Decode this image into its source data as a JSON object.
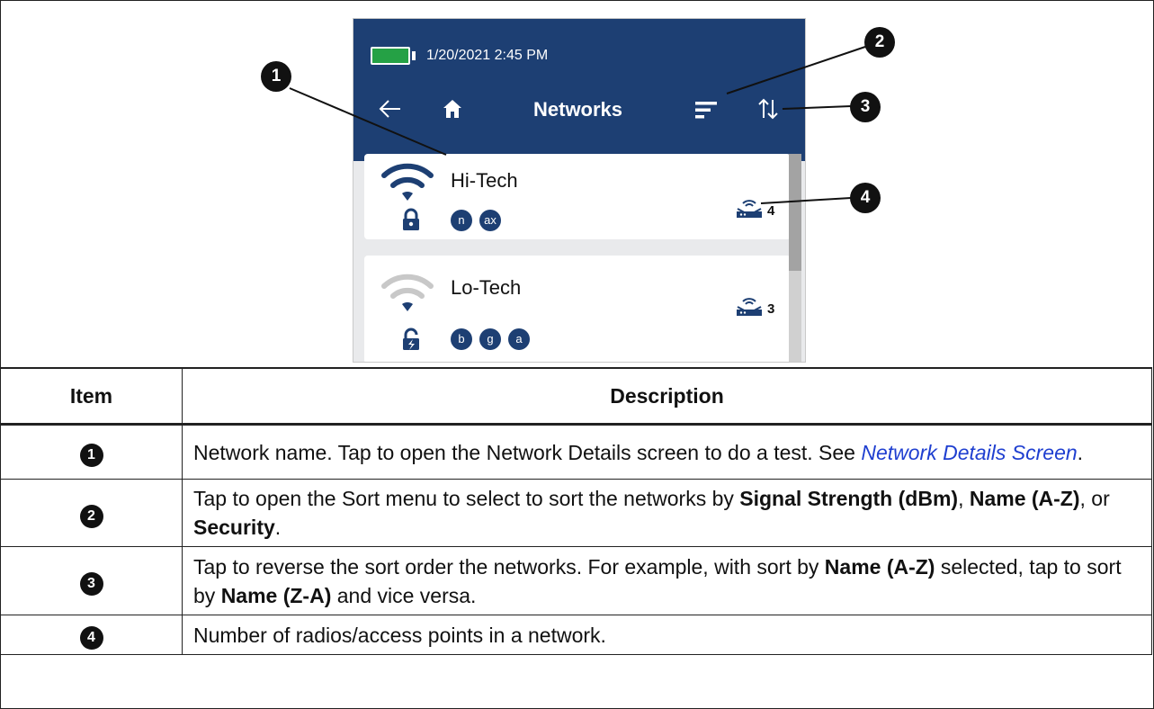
{
  "device": {
    "datetime": "1/20/2021 2:45 PM",
    "title": "Networks",
    "battery_color": "#25a145",
    "header_color": "#1d3f73",
    "networks": [
      {
        "name": "Hi-Tech",
        "signal": "strong",
        "security": "locked",
        "badges": [
          "n",
          "ax"
        ],
        "ap_count": "4"
      },
      {
        "name": "Lo-Tech",
        "signal": "weak",
        "security": "unlocked",
        "badges": [
          "b",
          "g",
          "a"
        ],
        "ap_count": "3"
      }
    ]
  },
  "callouts": [
    "1",
    "2",
    "3",
    "4"
  ],
  "table": {
    "headers": {
      "item": "Item",
      "description": "Description"
    },
    "rows": [
      {
        "item": "1",
        "t1": "Network name. Tap to open the Network Details screen to do a test. See ",
        "link": "Network Details Screen",
        "t2": "."
      },
      {
        "item": "2",
        "t1": "Tap to open the Sort menu to select to sort the networks by ",
        "b1": "Signal Strength (dBm)",
        "t2": ", ",
        "b2": "Name (A-Z)",
        "t3": ", or ",
        "b3": "Security",
        "t4": "."
      },
      {
        "item": "3",
        "t1": "Tap to reverse the sort order the networks. For example, with sort by ",
        "b1": "Name (A-Z)",
        "t2": " selected, tap to sort by ",
        "b2": "Name (Z-A)",
        "t3": " and vice versa."
      },
      {
        "item": "4",
        "t1": "Number of radios/access points in a network."
      }
    ]
  }
}
